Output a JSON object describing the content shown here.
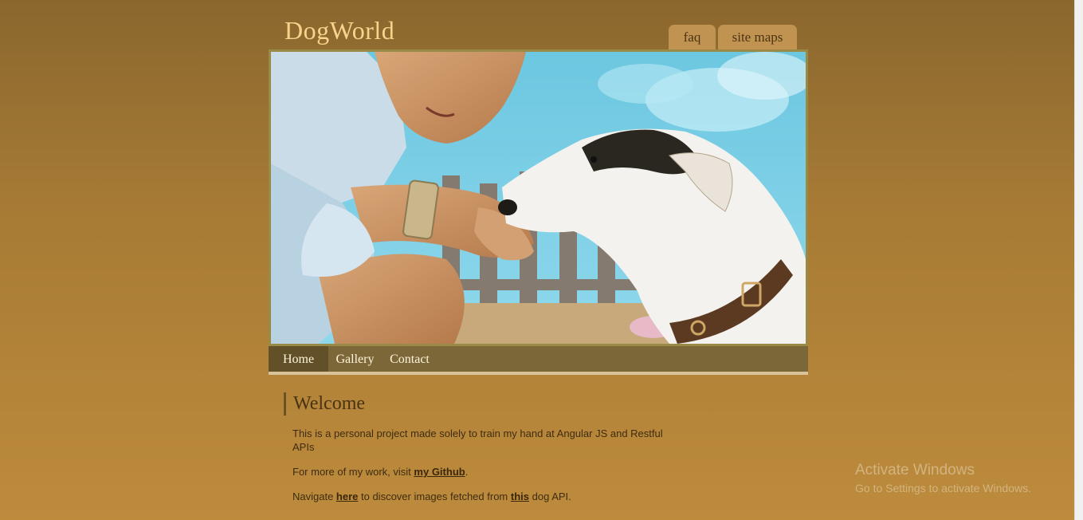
{
  "header": {
    "logo": "DogWorld",
    "top_tabs": [
      "faq",
      "site maps"
    ]
  },
  "hero": {
    "image": "woman-and-dog-photo"
  },
  "nav": {
    "items": [
      "Home",
      "Gallery",
      "Contact"
    ],
    "active": "Home"
  },
  "content": {
    "heading": "Welcome",
    "p1": "This is a personal project made solely to train my hand at Angular JS and Restful APIs",
    "p2_before": "For more of my work, visit ",
    "p2_link": "my Github",
    "p2_after": ".",
    "p3_before": "Navigate ",
    "p3_link1": "here",
    "p3_middle": " to discover images fetched from ",
    "p3_link2": "this",
    "p3_after": " dog API."
  },
  "watermark": {
    "title": "Activate Windows",
    "subtitle": "Go to Settings to activate Windows."
  },
  "colors": {
    "background_top": "#8a672e",
    "background_bottom": "#bd8b3c",
    "logo": "#f7d48c",
    "nav_bar": "#7c6739",
    "nav_active": "#625028"
  }
}
